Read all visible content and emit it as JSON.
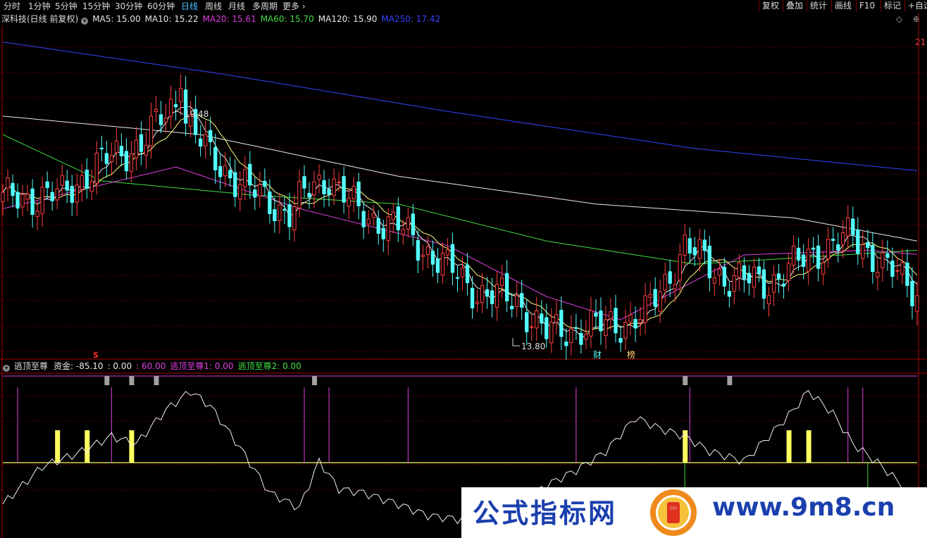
{
  "toolbar": {
    "periods": [
      "分时",
      "1分钟",
      "5分钟",
      "15分钟",
      "30分钟",
      "60分钟",
      "日线",
      "周线",
      "月线",
      "多周期",
      "更多"
    ],
    "active_period": "日线",
    "right_buttons": [
      "复权",
      "叠加",
      "统计",
      "画线",
      "F10",
      "标记",
      "+自选"
    ]
  },
  "main_legend": {
    "stock": "深科技(日线 前复权)",
    "ma": [
      {
        "label": "MA5: 15.00",
        "color": "#e8e8e8"
      },
      {
        "label": "MA10: 15.22",
        "color": "#e8e8e8"
      },
      {
        "label": "MA20: 15.61",
        "color": "#e040e0"
      },
      {
        "label": "MA60: 15.70",
        "color": "#44dd44"
      },
      {
        "label": "MA120: 15.90",
        "color": "#e8e8e8"
      },
      {
        "label": "MA250: 17.42",
        "color": "#3344ff"
      }
    ],
    "right_edge_label": "21"
  },
  "sub_legend": {
    "name": "逃顶至尊",
    "items": [
      {
        "label": "资金: -85.10",
        "color": "#e8e8e8"
      },
      {
        "label": ": 0.00",
        "color": "#e8e8e8"
      },
      {
        "label": ": 60.00",
        "color": "#e040e0"
      },
      {
        "label": "逃顶至尊1: 0.00",
        "color": "#e040e0"
      },
      {
        "label": "逃顶至尊2: 0.00",
        "color": "#44dd44"
      }
    ]
  },
  "annotations": {
    "high_label": "19.48",
    "low_label": "13.80",
    "marker_s": "S",
    "marker_cai": "财",
    "marker_bang": "榜"
  },
  "watermark": {
    "text": "公式指标网",
    "url": "www.9m8.cn"
  },
  "colors": {
    "up": "#ff4040",
    "down": "#54ffff",
    "ma5": "#e8e8e8",
    "ma10": "#ffff80",
    "ma20": "#e040e0",
    "ma60": "#44dd44",
    "ma120": "#e8e8e8",
    "ma250": "#3344ff",
    "signal": "#ffff60"
  },
  "chart_data": [
    {
      "type": "candlestick",
      "title": "",
      "y_range": [
        13.5,
        20.5
      ],
      "series": [
        {
          "name": "MA5"
        },
        {
          "name": "MA10"
        },
        {
          "name": "MA20"
        },
        {
          "name": "MA60"
        },
        {
          "name": "MA120"
        },
        {
          "name": "MA250"
        }
      ],
      "ma_approx": {
        "MA250": [
          [
            0,
            20.2
          ],
          [
            45,
            19.5
          ],
          [
            90,
            18.7
          ],
          [
            140,
            17.9
          ],
          [
            185,
            17.42
          ]
        ],
        "MA120": [
          [
            0,
            18.6
          ],
          [
            40,
            18.2
          ],
          [
            80,
            17.3
          ],
          [
            120,
            16.7
          ],
          [
            160,
            16.4
          ],
          [
            185,
            15.9
          ]
        ],
        "MA60": [
          [
            0,
            18.2
          ],
          [
            20,
            17.2
          ],
          [
            50,
            16.9
          ],
          [
            80,
            16.7
          ],
          [
            110,
            15.9
          ],
          [
            140,
            15.4
          ],
          [
            170,
            15.6
          ],
          [
            185,
            15.7
          ]
        ],
        "MA20": [
          [
            0,
            16.6
          ],
          [
            35,
            17.5
          ],
          [
            60,
            16.6
          ],
          [
            90,
            15.8
          ],
          [
            110,
            14.7
          ],
          [
            125,
            14.2
          ],
          [
            150,
            15.6
          ],
          [
            175,
            15.7
          ],
          [
            185,
            15.61
          ]
        ]
      },
      "annotations": [
        {
          "text": "19.48",
          "kind": "high"
        },
        {
          "text": "13.80",
          "kind": "low"
        }
      ]
    },
    {
      "type": "line",
      "title": "逃顶至尊",
      "y_range": [
        -100,
        100
      ],
      "reference_lines": [
        0,
        60
      ],
      "series": [
        {
          "name": "资金",
          "last": -85.1
        },
        {
          "name": "逃顶至尊1",
          "last": 0.0
        },
        {
          "name": "逃顶至尊2",
          "last": 0.0
        }
      ],
      "curve_approx": [
        [
          0,
          -55
        ],
        [
          8,
          -5
        ],
        [
          15,
          12
        ],
        [
          22,
          35
        ],
        [
          27,
          25
        ],
        [
          33,
          70
        ],
        [
          38,
          95
        ],
        [
          42,
          75
        ],
        [
          48,
          20
        ],
        [
          54,
          -40
        ],
        [
          60,
          -60
        ],
        [
          64,
          2
        ],
        [
          68,
          -35
        ],
        [
          73,
          -40
        ],
        [
          80,
          -55
        ],
        [
          86,
          -70
        ],
        [
          92,
          -75
        ],
        [
          98,
          -70
        ],
        [
          104,
          -55
        ],
        [
          110,
          -30
        ],
        [
          116,
          -10
        ],
        [
          122,
          15
        ],
        [
          128,
          60
        ],
        [
          133,
          45
        ],
        [
          138,
          35
        ],
        [
          143,
          15
        ],
        [
          150,
          2
        ],
        [
          155,
          35
        ],
        [
          160,
          70
        ],
        [
          163,
          95
        ],
        [
          168,
          65
        ],
        [
          172,
          25
        ],
        [
          177,
          0
        ],
        [
          182,
          -30
        ],
        [
          185,
          -60
        ]
      ]
    }
  ]
}
